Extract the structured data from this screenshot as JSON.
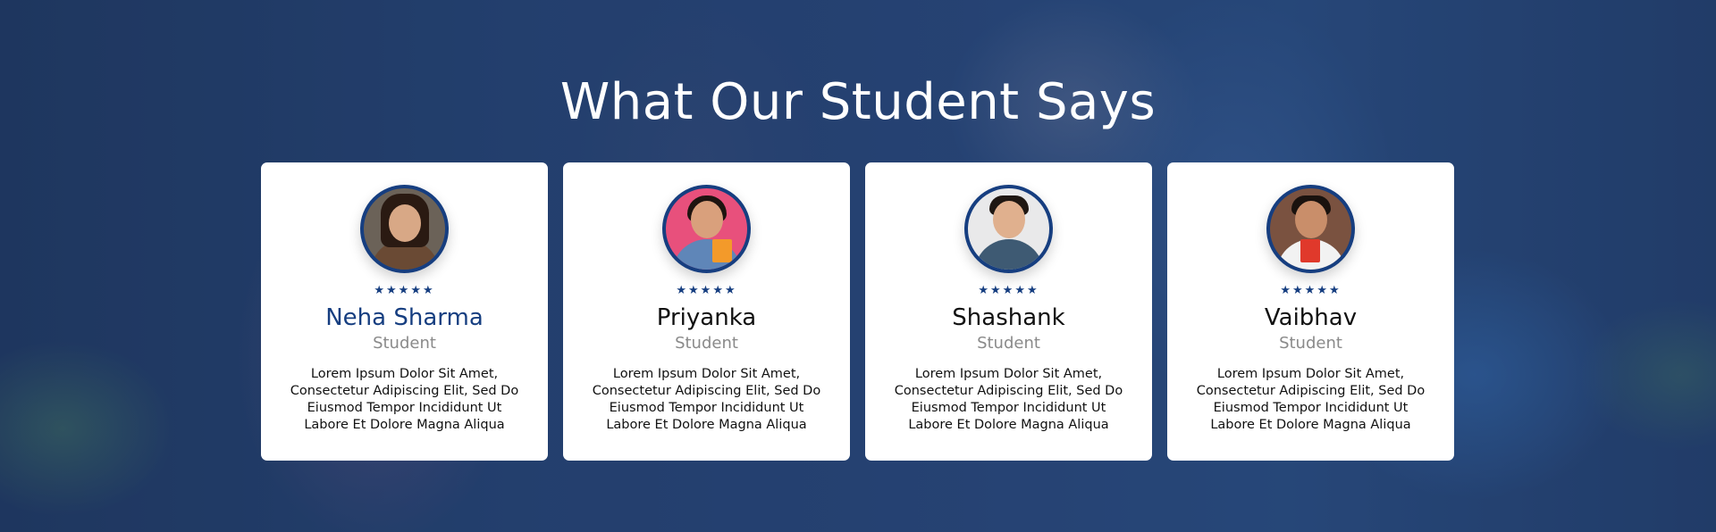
{
  "section": {
    "heading": "What Our Student Says"
  },
  "colors": {
    "accent": "#163e80",
    "card_bg": "#ffffff",
    "role_text": "#8a8a8a"
  },
  "testimonials": [
    {
      "name": "Neha Sharma",
      "role": "Student",
      "rating": 5,
      "stars": "★★★★★",
      "text": "Lorem Ipsum Dolor Sit Amet, Consectetur Adipiscing Elit, Sed Do Eiusmod Tempor Incididunt Ut Labore Et Dolore Magna Aliqua"
    },
    {
      "name": "Priyanka",
      "role": "Student",
      "rating": 5,
      "stars": "★★★★★",
      "text": "Lorem Ipsum Dolor Sit Amet, Consectetur Adipiscing Elit, Sed Do Eiusmod Tempor Incididunt Ut Labore Et Dolore Magna Aliqua"
    },
    {
      "name": "Shashank",
      "role": "Student",
      "rating": 5,
      "stars": "★★★★★",
      "text": "Lorem Ipsum Dolor Sit Amet, Consectetur Adipiscing Elit, Sed Do Eiusmod Tempor Incididunt Ut Labore Et Dolore Magna Aliqua"
    },
    {
      "name": "Vaibhav",
      "role": "Student",
      "rating": 5,
      "stars": "★★★★★",
      "text": "Lorem Ipsum Dolor Sit Amet, Consectetur Adipiscing Elit, Sed Do Eiusmod Tempor Incididunt Ut Labore Et Dolore Magna Aliqua"
    }
  ]
}
